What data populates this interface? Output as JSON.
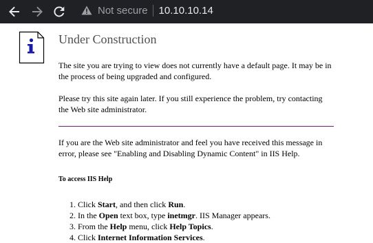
{
  "browser": {
    "security_label": "Not secure",
    "url": "10.10.10.14",
    "icons": {
      "back": "arrow-back-icon",
      "forward": "arrow-forward-icon",
      "reload": "reload-icon",
      "security": "warning-triangle-icon"
    }
  },
  "page": {
    "heading": "Under Construction",
    "para1": "The site you are trying to view does not currently have a default page. It may be in the process of being upgraded and configured.",
    "para2": "Please try this site again later. If you still experience the problem, try contacting the Web site administrator.",
    "para3": "If you are the Web site administrator and feel you have received this message in error, please see \"Enabling and Disabling Dynamic Content\" in IIS Help.",
    "subhead": "To access IIS Help",
    "steps": [
      {
        "pre": "Click ",
        "b1": "Start",
        "mid": ", and then click ",
        "b2": "Run",
        "post": "."
      },
      {
        "pre": "In the ",
        "b1": "Open",
        "mid": " text box, type ",
        "b2": "inetmgr",
        "post": ". IIS Manager appears."
      },
      {
        "pre": "From the ",
        "b1": "Help",
        "mid": " menu, click ",
        "b2": "Help Topics",
        "post": "."
      },
      {
        "pre": "Click ",
        "b1": "Internet Information Services",
        "mid": "",
        "b2": "",
        "post": "."
      }
    ],
    "icon": "info-icon"
  },
  "colors": {
    "toolbar_bg": "#202124",
    "rule": "#6b1f6f",
    "heading": "#4e4e4e",
    "info_blue": "#1a1aa6"
  }
}
